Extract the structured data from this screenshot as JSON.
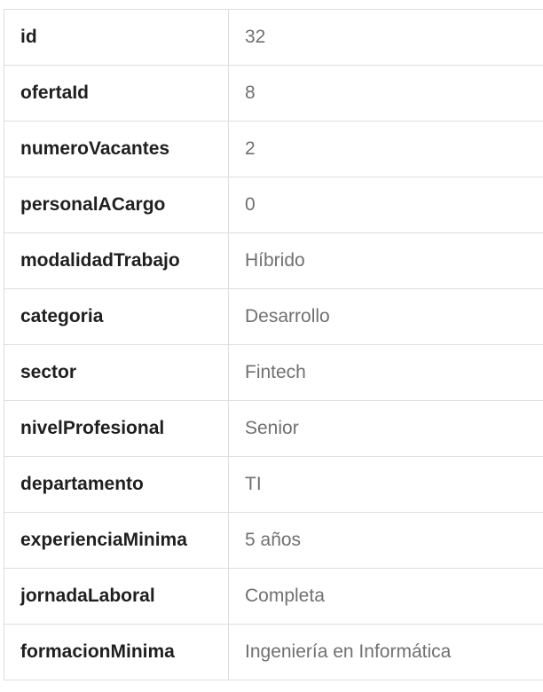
{
  "rows": [
    {
      "key": "id",
      "value": "32"
    },
    {
      "key": "ofertaId",
      "value": "8"
    },
    {
      "key": "numeroVacantes",
      "value": "2"
    },
    {
      "key": "personalACargo",
      "value": "0"
    },
    {
      "key": "modalidadTrabajo",
      "value": "Híbrido"
    },
    {
      "key": "categoria",
      "value": "Desarrollo"
    },
    {
      "key": "sector",
      "value": "Fintech"
    },
    {
      "key": "nivelProfesional",
      "value": "Senior"
    },
    {
      "key": "departamento",
      "value": "TI"
    },
    {
      "key": "experienciaMinima",
      "value": "5 años"
    },
    {
      "key": "jornadaLaboral",
      "value": "Completa"
    },
    {
      "key": "formacionMinima",
      "value": "Ingeniería en Informática"
    }
  ]
}
